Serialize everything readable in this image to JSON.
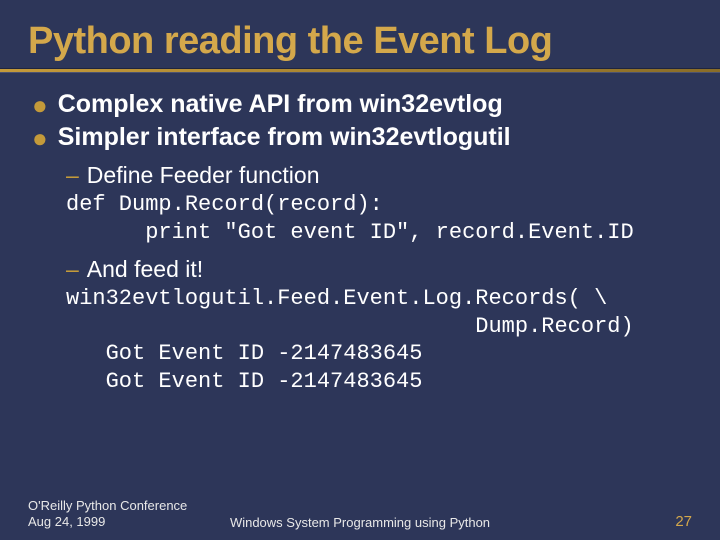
{
  "title": "Python reading the Event Log",
  "bullets": [
    "Complex native API from win32evtlog",
    "Simpler interface from win32evtlogutil"
  ],
  "sub1": "Define Feeder function",
  "code1_l1": "def Dump.Record(record):",
  "code1_l2": "      print \"Got event ID\", record.Event.ID",
  "sub2": "And feed it!",
  "code2_l1": "win32evtlogutil.Feed.Event.Log.Records( \\",
  "code2_l2": "                               Dump.Record)",
  "code2_l3": "   Got Event ID -2147483645",
  "code2_l4": "   Got Event ID -2147483645",
  "footer": {
    "left_l1": "O'Reilly Python Conference",
    "left_l2": "Aug 24, 1999",
    "center": "Windows System Programming using Python",
    "page": "27"
  }
}
